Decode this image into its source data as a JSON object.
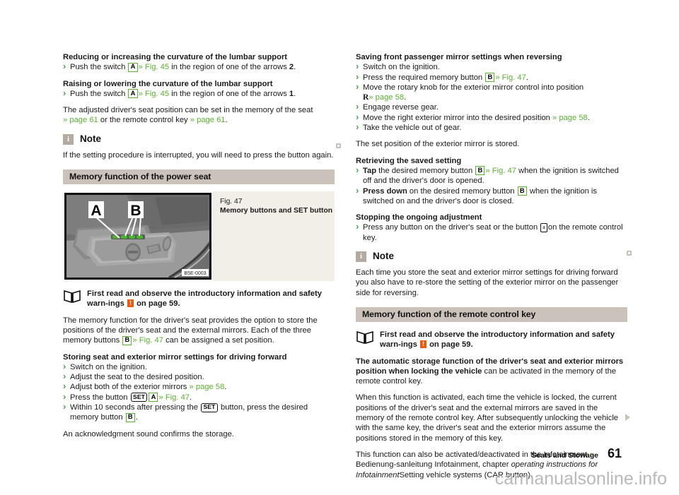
{
  "document": {
    "footer_section": "Seats and Stowage",
    "page_number": "61",
    "watermark": "carmanualsonline.info"
  },
  "left_column": {
    "lumbar_curvature": {
      "heading": "Reducing or increasing the curvature of the lumbar support",
      "step_pre": "Push the switch",
      "key": "A",
      "ref": "» Fig. 45",
      "step_mid": "in the region of one of the arrows",
      "arrow": "2",
      "period": "."
    },
    "lumbar_raise": {
      "heading": "Raising or lowering the curvature of the lumbar support",
      "step_pre": "Push the switch",
      "key": "A",
      "ref": "» Fig. 45",
      "step_mid": "in the region of one of the arrows",
      "arrow": "1",
      "period": "."
    },
    "adjusted_seat": {
      "part1": "The adjusted driver's seat position can be set in the memory of the seat",
      "ref1": "» page 61",
      "part2": "or the remote control key",
      "ref2": "» page 61",
      "part3": "."
    },
    "note1": {
      "icon_letter": "i",
      "title": "Note",
      "body": "If the setting procedure is interrupted, you will need to press the button again."
    },
    "section_header": "Memory function of the power seat",
    "figure": {
      "number": "Fig. 47",
      "title": "Memory buttons and SET button",
      "image_code": "B5E-0003",
      "label_a": "A",
      "label_b": "B"
    },
    "read_first": {
      "text_part1": "First read and observe the introductory information and safety warn-ings",
      "marker": "!",
      "text_part2": "on page 59."
    },
    "intro": {
      "part1": "The memory function for the driver's seat provides the option to store the positions of the driver's seat and the external mirrors. Each of the three memory buttons",
      "key": "B",
      "ref": "» Fig. 47",
      "part2": "can be assigned a set position."
    },
    "storing": {
      "heading": "Storing seat and exterior mirror settings for driving forward",
      "steps": [
        {
          "text": "Switch on the ignition."
        },
        {
          "text": "Adjust the seat to the desired position."
        },
        {
          "text": "Adjust both of the exterior mirrors",
          "ref": "» page 58",
          "after": "."
        },
        {
          "text": "Press the button",
          "setbtn": "SET",
          "key": "A",
          "ref": "» Fig. 47",
          "after": "."
        },
        {
          "text": "Within 10 seconds after pressing the",
          "setbtn2": "SET",
          "text2": "button, press the desired memory button",
          "key2": "B",
          "after": "."
        }
      ],
      "closing": "An acknowledgment sound confirms the storage."
    }
  },
  "right_column": {
    "saving_passenger": {
      "heading": "Saving front passenger mirror settings when reversing",
      "steps": [
        {
          "text": "Switch on the ignition."
        },
        {
          "text": "Press the required memory button",
          "key": "B",
          "ref": "» Fig. 47",
          "after": "."
        },
        {
          "text": "Move the rotary knob for the exterior mirror control into position",
          "glyph": "R",
          "ref": "» page 58",
          "after": "."
        },
        {
          "text": "Engage reverse gear."
        },
        {
          "text": "Move the right exterior mirror into the desired position",
          "ref": "» page 58",
          "after": "."
        },
        {
          "text": "Take the vehicle out of gear."
        }
      ],
      "closing": "The set position of the exterior mirror is stored."
    },
    "retrieving": {
      "heading": "Retrieving the saved setting",
      "step1_bold": "Tap",
      "step1_a": "the desired memory button",
      "step1_key": "B",
      "step1_ref": "» Fig. 47",
      "step1_b": "when the ignition is switched off and the driver's door is opened.",
      "step2_bold": "Press down",
      "step2_a": "on the desired memory button",
      "step2_key": "B",
      "step2_b": "when the ignition is switched on and the driver's door is closed."
    },
    "stopping": {
      "heading": "Stopping the ongoing adjustment",
      "step_a": "Press any button on the driver's seat or the button",
      "glyph": "a",
      "step_b": "on the remote control key."
    },
    "note2": {
      "icon_letter": "i",
      "title": "Note",
      "body": "Each time you store the seat and exterior mirror settings for driving forward you also have to re-store the setting of the exterior mirror on the passenger side for reversing."
    },
    "section_header": "Memory function of the remote control key",
    "read_first": {
      "text_part1": "First read and observe the introductory information and safety warn-ings",
      "marker": "!",
      "text_part2": "on page 59."
    },
    "auto_storage": {
      "bold": "The automatic storage function of the driver's seat and exterior mirrors position when locking the vehicle",
      "rest": "can be activated in the memory of the remote control key."
    },
    "activated_para": "When this function is activated, each time the vehicle is locked, the current positions of the driver's seat and the external mirrors are saved in the memory of the remote control key. After subsequently unlocking the vehicle with the same key, the driver's seat and the exterior mirrors assume the positions stored in the memory of this key.",
    "infotainment": {
      "part1": "This function can also be activated/deactivated in the Infotainment",
      "ref": "»",
      "part2": "Bedienung-sanleitung Infotainment, chapter",
      "italic": "operating instructions for Infotainment",
      "part3": "Setting vehicle systems (CAR button)."
    }
  }
}
